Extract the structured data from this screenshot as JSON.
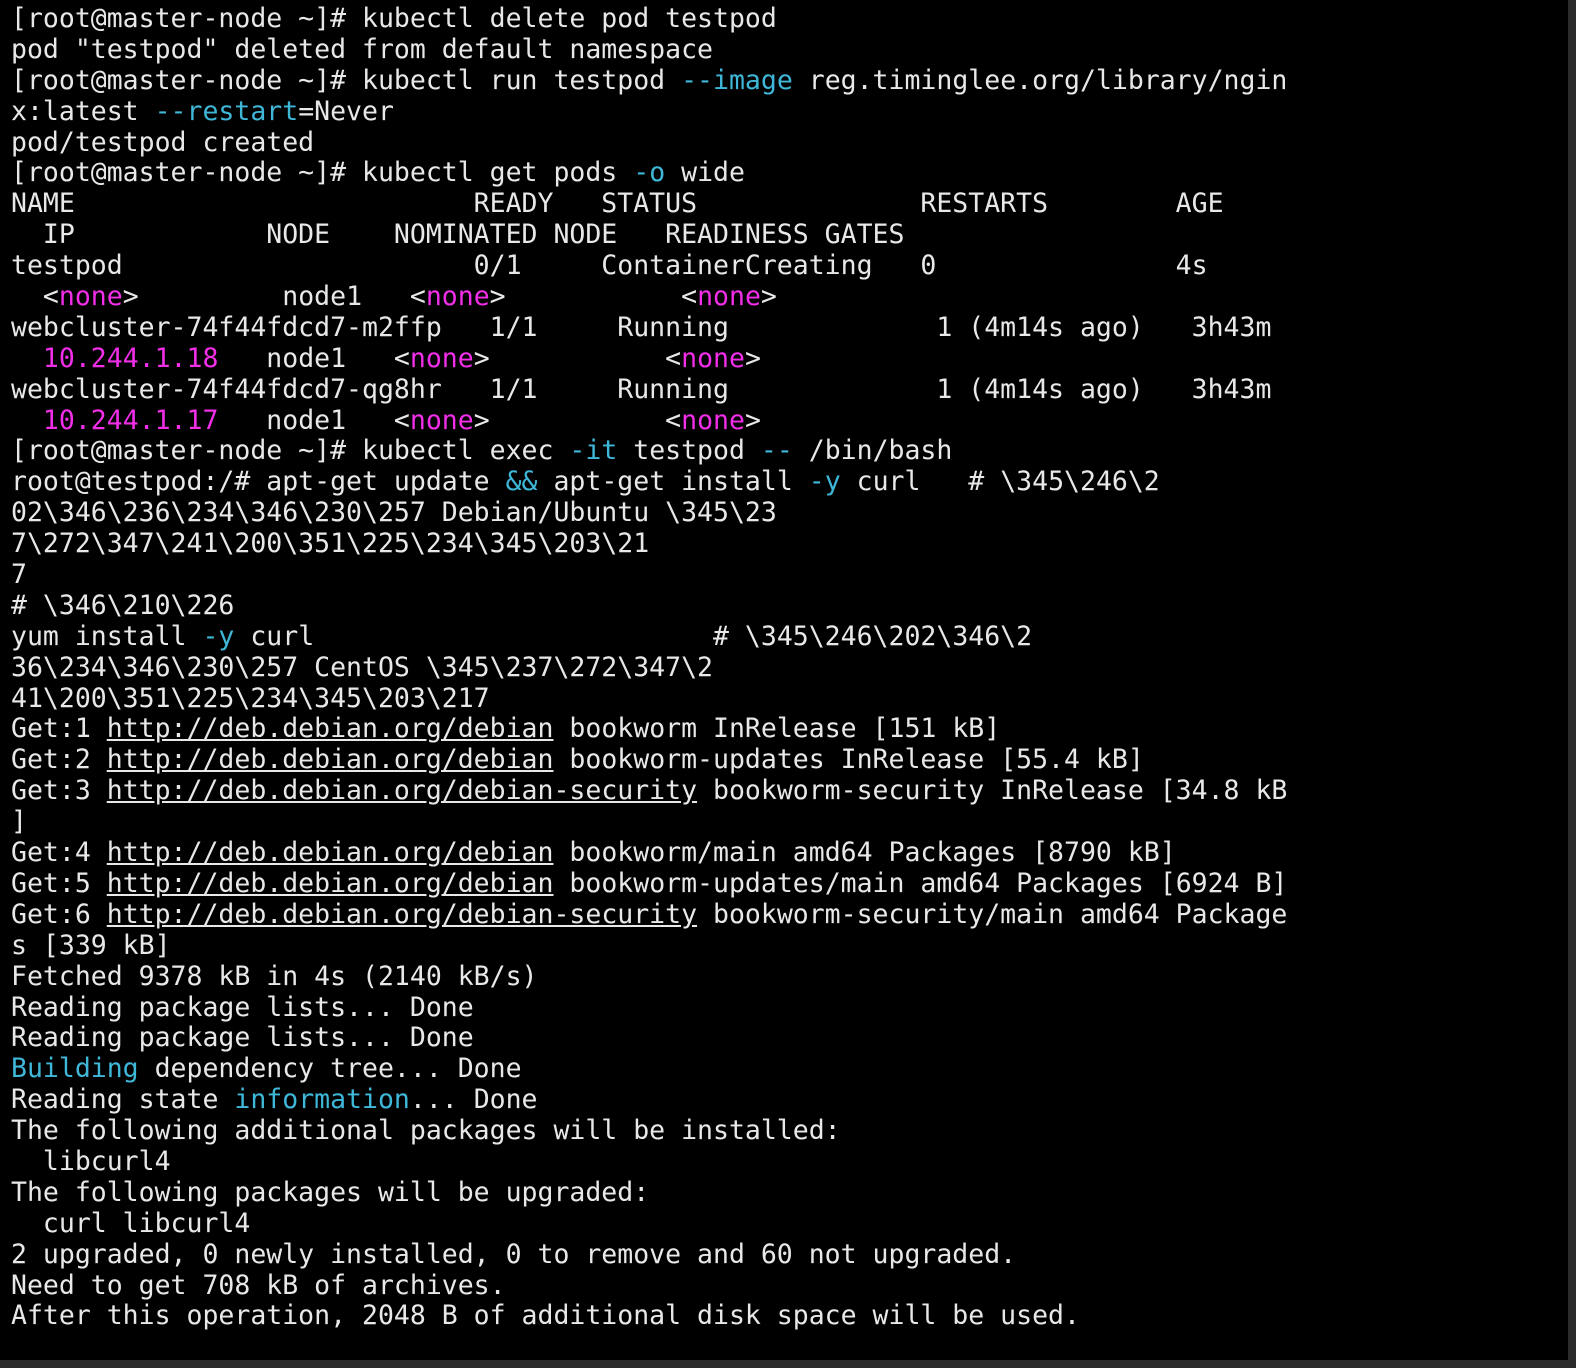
{
  "terminal": {
    "colors": {
      "background": "#000000",
      "text": "#e8e8e8",
      "cyan": "#3fb7d8",
      "magenta": "#f22ee9"
    },
    "lines": [
      [
        {
          "t": "[root@master-node ~]# kubectl delete pod testpod"
        }
      ],
      [
        {
          "t": "pod \"testpod\" deleted from default namespace"
        }
      ],
      [
        {
          "t": "[root@master-node ~]# kubectl run testpod "
        },
        {
          "t": "--image",
          "s": "cyan"
        },
        {
          "t": " reg.timinglee.org/library/ngin"
        }
      ],
      [
        {
          "t": "x:latest "
        },
        {
          "t": "--restart",
          "s": "cyan"
        },
        {
          "t": "=Never"
        }
      ],
      [
        {
          "t": "pod/testpod created"
        }
      ],
      [
        {
          "t": "[root@master-node ~]# kubectl get pods "
        },
        {
          "t": "-o",
          "s": "cyan"
        },
        {
          "t": " wide"
        }
      ],
      [
        {
          "t": "NAME                         READY   STATUS              RESTARTS        AGE"
        }
      ],
      [
        {
          "t": "  IP            NODE    NOMINATED NODE   READINESS GATES"
        }
      ],
      [
        {
          "t": "testpod                      0/1     ContainerCreating   0               4s"
        }
      ],
      [
        {
          "t": "  <"
        },
        {
          "t": "none",
          "s": "magenta"
        },
        {
          "t": ">         node1   <"
        },
        {
          "t": "none",
          "s": "magenta"
        },
        {
          "t": ">           <"
        },
        {
          "t": "none",
          "s": "magenta"
        },
        {
          "t": ">"
        }
      ],
      [
        {
          "t": "webcluster-74f44fdcd7-m2ffp   1/1     Running             1 (4m14s ago)   3h43m"
        }
      ],
      [
        {
          "t": "  "
        },
        {
          "t": "10.244.1.18",
          "s": "magenta"
        },
        {
          "t": "   node1   <"
        },
        {
          "t": "none",
          "s": "magenta"
        },
        {
          "t": ">           <"
        },
        {
          "t": "none",
          "s": "magenta"
        },
        {
          "t": ">"
        }
      ],
      [
        {
          "t": "webcluster-74f44fdcd7-qg8hr   1/1     Running             1 (4m14s ago)   3h43m"
        }
      ],
      [
        {
          "t": "  "
        },
        {
          "t": "10.244.1.17",
          "s": "magenta"
        },
        {
          "t": "   node1   <"
        },
        {
          "t": "none",
          "s": "magenta"
        },
        {
          "t": ">           <"
        },
        {
          "t": "none",
          "s": "magenta"
        },
        {
          "t": ">"
        }
      ],
      [
        {
          "t": "[root@master-node ~]# kubectl exec "
        },
        {
          "t": "-it",
          "s": "cyan"
        },
        {
          "t": " testpod "
        },
        {
          "t": "--",
          "s": "cyan"
        },
        {
          "t": " /bin/bash"
        }
      ],
      [
        {
          "t": "root@testpod:/# apt-get update "
        },
        {
          "t": "&&",
          "s": "cyan"
        },
        {
          "t": " apt-get install "
        },
        {
          "t": "-y",
          "s": "cyan"
        },
        {
          "t": " curl   # \\345\\246\\2"
        }
      ],
      [
        {
          "t": "02\\346\\236\\234\\346\\230\\257 Debian/Ubuntu \\345\\23"
        }
      ],
      [
        {
          "t": "7\\272\\347\\241\\200\\351\\225\\234\\345\\203\\21"
        }
      ],
      [
        {
          "t": "7"
        }
      ],
      [
        {
          "t": "# \\346\\210\\226"
        }
      ],
      [
        {
          "t": "yum install "
        },
        {
          "t": "-y",
          "s": "cyan"
        },
        {
          "t": " curl                         # \\345\\246\\202\\346\\2"
        }
      ],
      [
        {
          "t": "36\\234\\346\\230\\257 CentOS \\345\\237\\272\\347\\2"
        }
      ],
      [
        {
          "t": "41\\200\\351\\225\\234\\345\\203\\217"
        }
      ],
      [
        {
          "t": "Get:1 "
        },
        {
          "t": "http://deb.debian.org/debian",
          "s": "link"
        },
        {
          "t": " bookworm InRelease [151 kB]"
        }
      ],
      [
        {
          "t": "Get:2 "
        },
        {
          "t": "http://deb.debian.org/debian",
          "s": "link"
        },
        {
          "t": " bookworm-updates InRelease [55.4 kB]"
        }
      ],
      [
        {
          "t": "Get:3 "
        },
        {
          "t": "http://deb.debian.org/debian-security",
          "s": "link"
        },
        {
          "t": " bookworm-security InRelease [34.8 kB"
        }
      ],
      [
        {
          "t": "]"
        }
      ],
      [
        {
          "t": "Get:4 "
        },
        {
          "t": "http://deb.debian.org/debian",
          "s": "link"
        },
        {
          "t": " bookworm/main amd64 Packages [8790 kB]"
        }
      ],
      [
        {
          "t": "Get:5 "
        },
        {
          "t": "http://deb.debian.org/debian",
          "s": "link"
        },
        {
          "t": " bookworm-updates/main amd64 Packages [6924 B]"
        }
      ],
      [
        {
          "t": "Get:6 "
        },
        {
          "t": "http://deb.debian.org/debian-security",
          "s": "link"
        },
        {
          "t": " bookworm-security/main amd64 Package"
        }
      ],
      [
        {
          "t": "s [339 kB]"
        }
      ],
      [
        {
          "t": "Fetched 9378 kB in 4s (2140 kB/s)"
        }
      ],
      [
        {
          "t": "Reading package lists... Done"
        }
      ],
      [
        {
          "t": "Reading package lists... Done"
        }
      ],
      [
        {
          "t": "Building",
          "s": "cyan"
        },
        {
          "t": " dependency tree... Done"
        }
      ],
      [
        {
          "t": "Reading state "
        },
        {
          "t": "information",
          "s": "cyan"
        },
        {
          "t": "... Done"
        }
      ],
      [
        {
          "t": "The following additional packages will be installed:"
        }
      ],
      [
        {
          "t": "  libcurl4"
        }
      ],
      [
        {
          "t": "The following packages will be upgraded:"
        }
      ],
      [
        {
          "t": "  curl libcurl4"
        }
      ],
      [
        {
          "t": "2 upgraded, 0 newly installed, 0 to remove and 60 not upgraded."
        }
      ],
      [
        {
          "t": "Need to get 708 kB of archives."
        }
      ],
      [
        {
          "t": "After this operation, 2048 B of additional disk space will be used."
        }
      ]
    ]
  }
}
